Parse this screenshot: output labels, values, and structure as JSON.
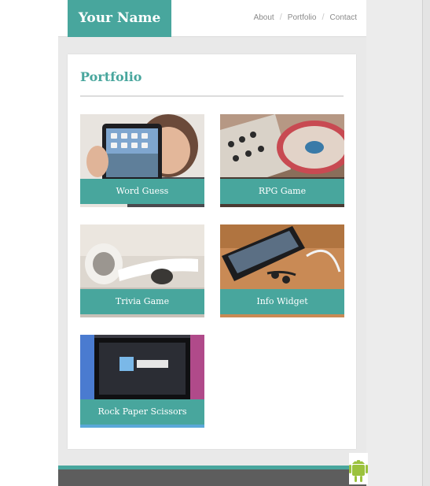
{
  "header": {
    "brand": "Your Name",
    "nav": [
      "About",
      "Portfolio",
      "Contact"
    ]
  },
  "main": {
    "title": "Portfolio",
    "projects": [
      {
        "label": "Word Guess",
        "image": "person-holding-tablet-photo"
      },
      {
        "label": "RPG Game",
        "image": "synthesizer-turntable-photo"
      },
      {
        "label": "Trivia Game",
        "image": "earbuds-photo"
      },
      {
        "label": "Info Widget",
        "image": "smartphone-with-earphones-photo"
      },
      {
        "label": "Rock Paper Scissors",
        "image": "led-tv-photo"
      }
    ]
  },
  "overlay": {
    "icon": "android-icon"
  },
  "colors": {
    "accent": "#48a69d",
    "page_bg": "#e9e9e9",
    "footer": "#5d5d5d",
    "nav_text": "#8a8a8a"
  }
}
